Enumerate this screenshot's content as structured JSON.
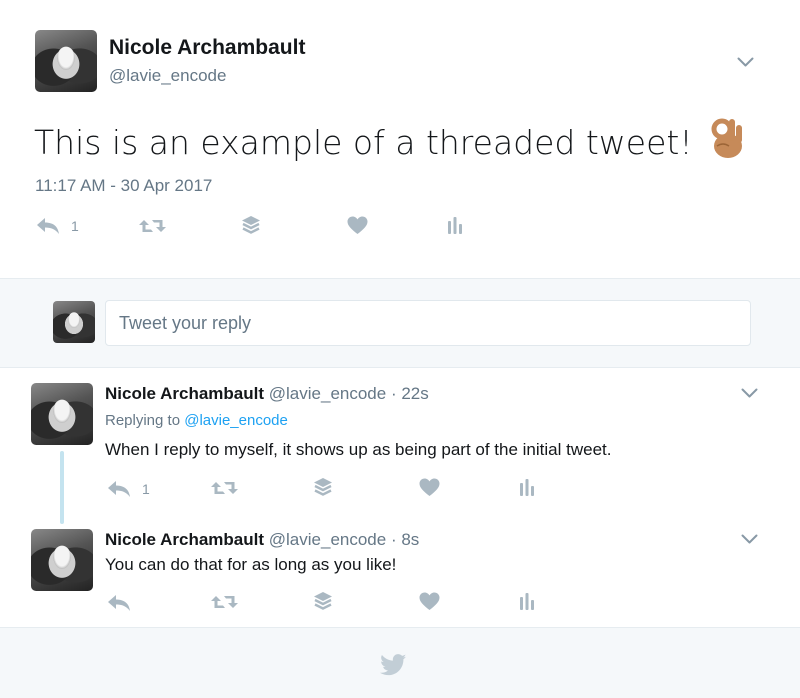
{
  "main_tweet": {
    "name": "Nicole Archambault",
    "handle": "@lavie_encode",
    "text": "This is an example of a threaded tweet!",
    "emoji": "👌🏽",
    "timestamp": "11:17 AM - 30 Apr 2017",
    "reply_count": "1"
  },
  "reply_box": {
    "placeholder": "Tweet your reply"
  },
  "replies": [
    {
      "name": "Nicole Archambault",
      "handle": "@lavie_encode",
      "time": "· 22s",
      "replying_label": "Replying to",
      "replying_to": "@lavie_encode",
      "text": "When I reply to myself, it shows up as being part of the initial tweet.",
      "reply_count": "1"
    },
    {
      "name": "Nicole Archambault",
      "handle": "@lavie_encode",
      "time": "· 8s",
      "text": "You can do that for as long as you like!",
      "reply_count": ""
    }
  ],
  "colors": {
    "icon_gray": "#aab8c2",
    "link_blue": "#1da1f2",
    "meta_gray": "#657786",
    "thread_line": "#c4e3ef",
    "footer_bg": "#f5f8fa"
  },
  "icons": [
    "reply-icon",
    "retweet-icon",
    "stack-icon",
    "heart-icon",
    "analytics-icon",
    "chevron-down-icon",
    "twitter-bird-icon"
  ]
}
